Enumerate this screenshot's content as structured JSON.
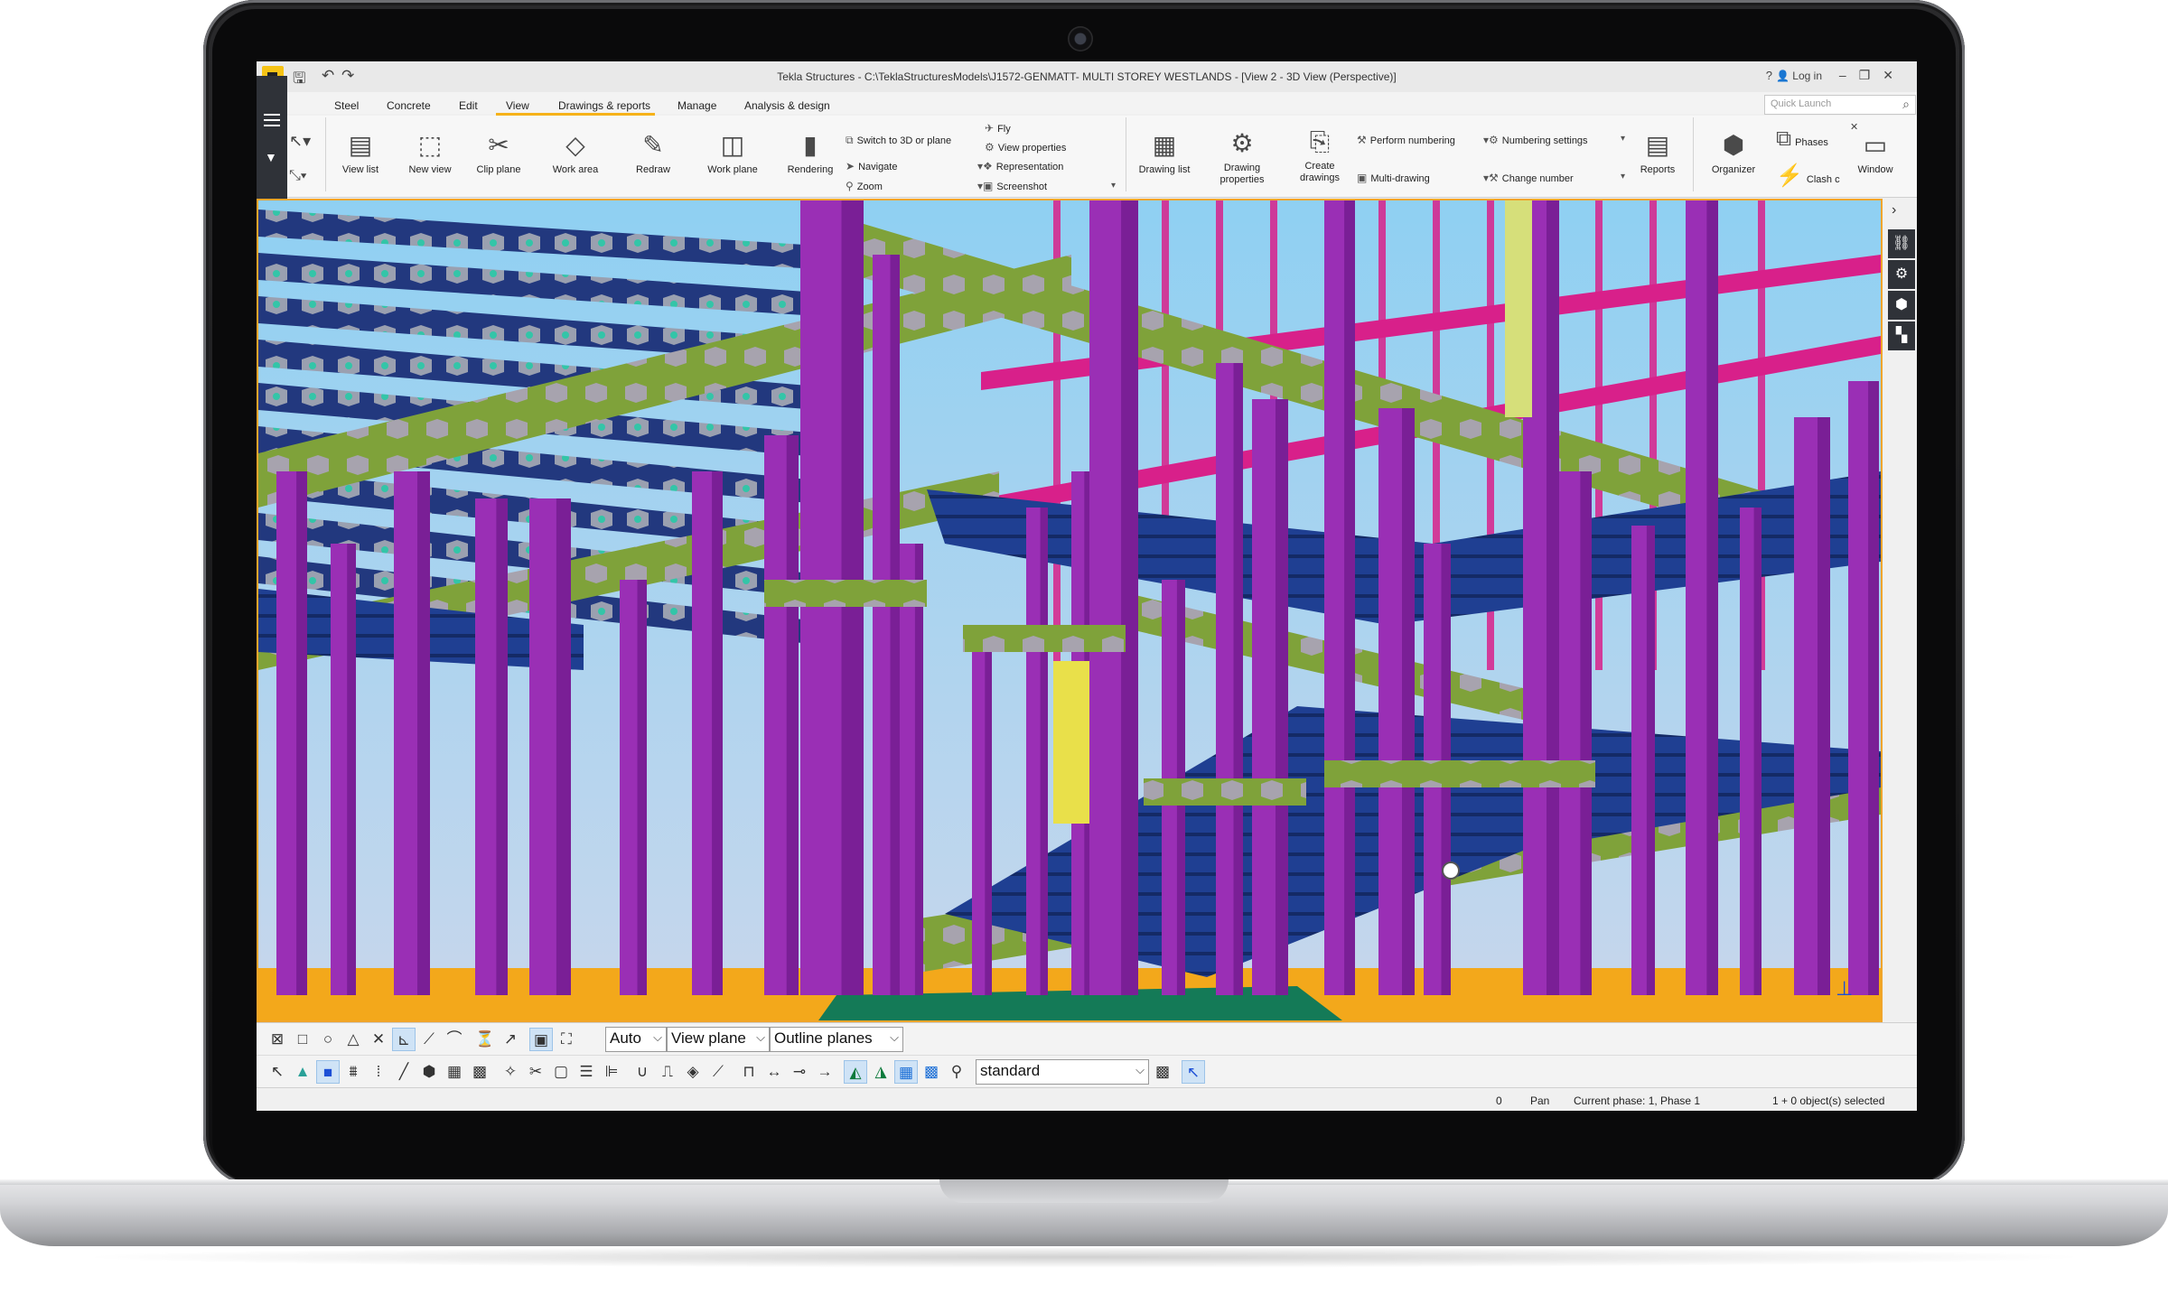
{
  "app": {
    "title": "Tekla Structures - C:\\TeklaStructuresModels\\J1572-GENMATT- MULTI STOREY WESTLANDS - [View 2 - 3D View (Perspective)]",
    "login": "Log in",
    "quick_launch_placeholder": "Quick Launch"
  },
  "menu": {
    "tabs": [
      "Steel",
      "Concrete",
      "Edit",
      "View",
      "Drawings & reports",
      "Manage",
      "Analysis & design"
    ],
    "active": "View"
  },
  "ribbon": {
    "view_list": "View list",
    "new_view": "New view",
    "clip_plane": "Clip plane",
    "work_area": "Work area",
    "redraw": "Redraw",
    "work_plane": "Work plane",
    "rendering": "Rendering",
    "switch_3d": "Switch to 3D or plane",
    "navigate": "Navigate",
    "zoom": "Zoom",
    "fly": "Fly",
    "view_properties": "View properties",
    "representation": "Representation",
    "screenshot": "Screenshot",
    "drawing_list": "Drawing list",
    "drawing_properties": "Drawing properties",
    "create_drawings": "Create drawings",
    "perform_numbering": "Perform numbering",
    "multi_drawing": "Multi-drawing",
    "numbering_settings": "Numbering settings",
    "change_number": "Change number",
    "reports": "Reports",
    "organizer": "Organizer",
    "phases": "Phases",
    "clash": "Clash c",
    "window": "Window"
  },
  "toolbar": {
    "snap_depth": "Auto",
    "snap_plane": "View plane",
    "snap_planes": "Outline planes",
    "filter": "standard"
  },
  "status": {
    "count": "0",
    "mode": "Pan",
    "phase": "Current phase: 1, Phase 1",
    "selected": "1 + 0 object(s) selected"
  },
  "colors": {
    "accent": "#f6b219",
    "column_purple": "#9a2fb5",
    "beam_green": "#7fa23a",
    "deck_blue": "#1f3f92",
    "foundation_orange": "#f3a81b",
    "brace_pink": "#d8208a"
  }
}
